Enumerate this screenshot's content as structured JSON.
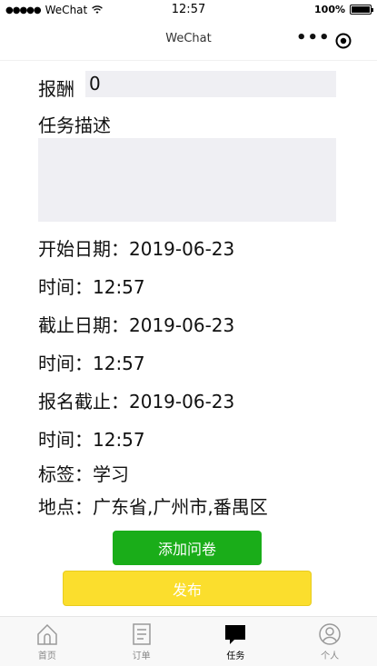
{
  "status_bar": {
    "dots": "●●●●●",
    "carrier": "WeChat",
    "time": "12:57",
    "battery": "100%"
  },
  "nav": {
    "title": "WeChat"
  },
  "form": {
    "reward_label": "报酬",
    "reward_value": "0",
    "desc_label": "任务描述",
    "desc_value": "",
    "start_date": "开始日期：2019-06-23",
    "start_time": "时间：12:57",
    "end_date": "截止日期：2019-06-23",
    "end_time": "时间：12:57",
    "signup_date": "报名截止：2019-06-23",
    "signup_time": "时间：12:57",
    "tags": "标签：学习",
    "location": "地点：广东省,广州市,番禺区"
  },
  "buttons": {
    "add_survey": "添加问卷",
    "publish": "发布"
  },
  "tabs": [
    {
      "label": "首页",
      "icon": "home-icon"
    },
    {
      "label": "订单",
      "icon": "order-icon"
    },
    {
      "label": "任务",
      "icon": "task-icon"
    },
    {
      "label": "个人",
      "icon": "profile-icon"
    }
  ],
  "colors": {
    "primary_green": "#1aad19",
    "publish_yellow": "#fbde2d",
    "input_bg": "#efeff3"
  }
}
